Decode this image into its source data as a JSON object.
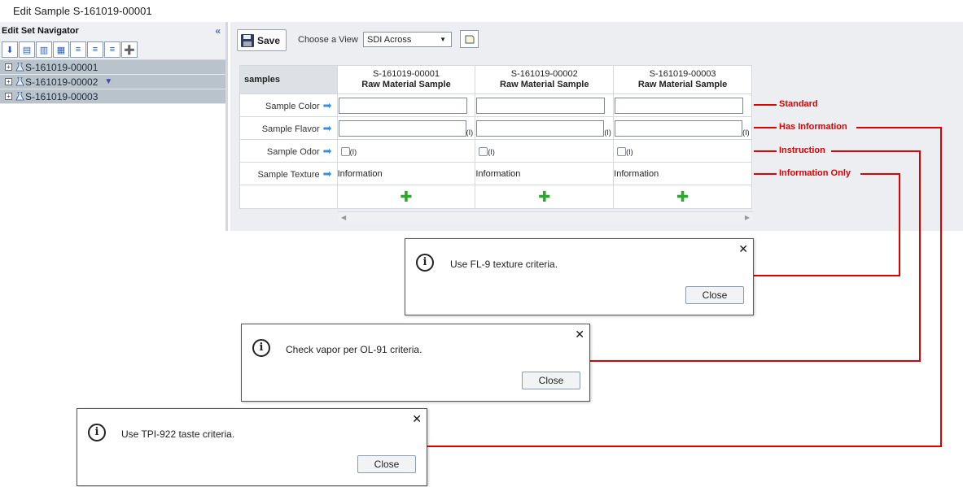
{
  "page": {
    "title": "Edit Sample S-161019-00001"
  },
  "navigator": {
    "title": "Edit Set Navigator",
    "collapse_label": "«",
    "tree": [
      {
        "label": "S-161019-00001"
      },
      {
        "label": "S-161019-00002"
      },
      {
        "label": "S-161019-00003"
      }
    ]
  },
  "toolbar": {
    "save_label": "Save",
    "view_label": "Choose a View",
    "view_value": "SDI Across"
  },
  "grid": {
    "corner_label": "samples",
    "columns": [
      {
        "id": "S-161019-00001",
        "type": "Raw Material Sample"
      },
      {
        "id": "S-161019-00002",
        "type": "Raw Material Sample"
      },
      {
        "id": "S-161019-00003",
        "type": "Raw Material Sample"
      }
    ],
    "rows": [
      {
        "label": "Sample Color"
      },
      {
        "label": "Sample Flavor"
      },
      {
        "label": "Sample Odor"
      },
      {
        "label": "Sample Texture"
      }
    ],
    "info_marker": "(I)",
    "texture_value": "Information"
  },
  "legend": {
    "standard": "Standard",
    "has_information": "Has Information",
    "instruction": "Instruction",
    "information_only": "Information Only"
  },
  "dialogs": [
    {
      "message": "Use FL-9 texture criteria.",
      "close_label": "Close"
    },
    {
      "message": "Check vapor per OL-91 criteria.",
      "close_label": "Close"
    },
    {
      "message": "Use TPI-922 taste criteria.",
      "close_label": "Close"
    }
  ],
  "colors": {
    "annotation": "#e00000",
    "arrow": "#3b8fd6",
    "add": "#2aa82a"
  }
}
